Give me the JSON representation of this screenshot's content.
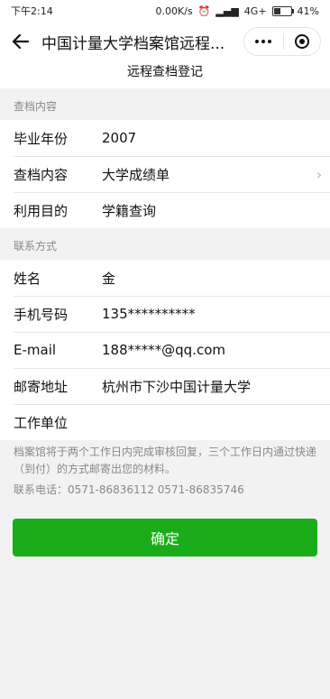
{
  "status": {
    "time": "下午2:14",
    "network_speed": "0.00K/s",
    "network_type": "4G+",
    "battery": "41%",
    "battery_level": 0.41
  },
  "nav": {
    "title": "中国计量大学档案馆远程..."
  },
  "subtitle": "远程查档登记",
  "section_query": {
    "header": "查档内容",
    "rows": [
      {
        "label": "毕业年份",
        "value": "2007"
      },
      {
        "label": "查档内容",
        "value": "大学成绩单"
      },
      {
        "label": "利用目的",
        "value": "学籍查询"
      }
    ]
  },
  "section_contact": {
    "header": "联系方式",
    "rows": [
      {
        "label": "姓名",
        "value": "金"
      },
      {
        "label": "手机号码",
        "value": "135**********"
      },
      {
        "label": "E-mail",
        "value": "188*****@qq.com"
      },
      {
        "label": "邮寄地址",
        "value": "杭州市下沙中国计量大学"
      },
      {
        "label": "工作单位",
        "value": ""
      }
    ]
  },
  "notice": {
    "text": "档案馆将于两个工作日内完成审核回复，三个工作日内通过快递（到付）的方式邮寄出您的材料。",
    "phone": "联系电话：0571-86836112 0571-86835746"
  },
  "confirm_label": "确定"
}
